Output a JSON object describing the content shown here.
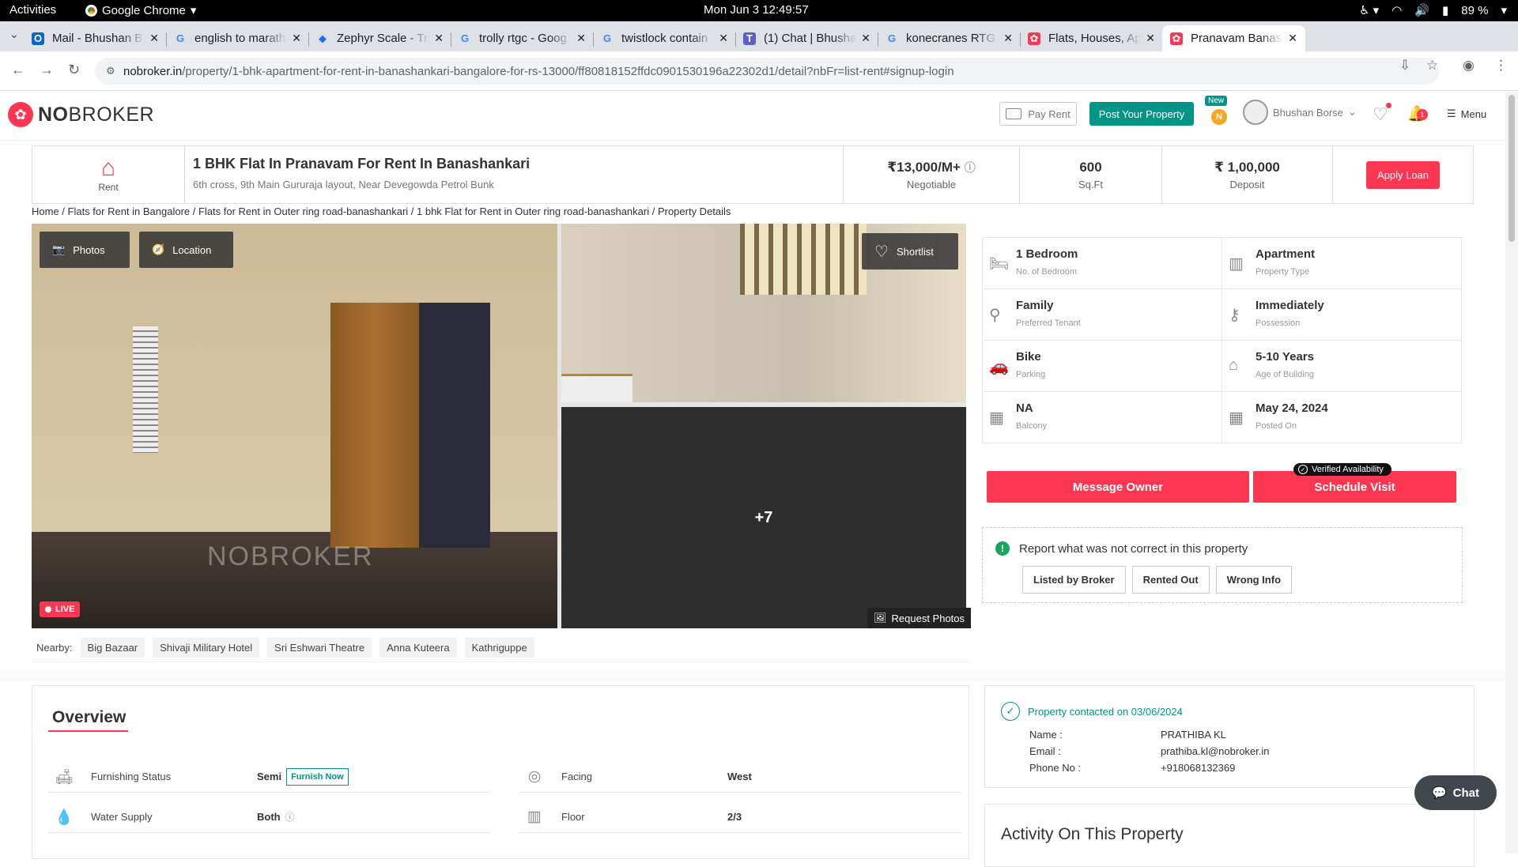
{
  "system": {
    "activities": "Activities",
    "app_name": "Google Chrome",
    "clock": "Mon Jun 3  12:49:57",
    "battery": "89 %"
  },
  "tabs": [
    {
      "title": "Mail - Bhushan B",
      "icon": "outlook-icon"
    },
    {
      "title": "english to marathi",
      "icon": "google-icon"
    },
    {
      "title": "Zephyr Scale - Tr",
      "icon": "zephyr-icon"
    },
    {
      "title": "trolly rtgc - Goog",
      "icon": "google-icon"
    },
    {
      "title": "twistlock contain",
      "icon": "google-icon"
    },
    {
      "title": "(1) Chat | Bhusha",
      "icon": "teams-icon"
    },
    {
      "title": "konecranes RTG",
      "icon": "google-icon"
    },
    {
      "title": "Flats, Houses, Ap",
      "icon": "nobroker-icon"
    },
    {
      "title": "Pranavam Banasl",
      "icon": "nobroker-icon",
      "active": true
    }
  ],
  "address_bar": {
    "host": "nobroker.in",
    "path": "/property/1-bhk-apartment-for-rent-in-banashankari-bangalore-for-rs-13000/ff80818152ffdc0901530196a22302d1/detail?nbFr=list-rent#signup-login"
  },
  "header": {
    "logo_bold": "NO",
    "logo_rest": "BROKER",
    "pay_rent": "Pay Rent",
    "post_property": "Post Your Property",
    "new_badge": "New",
    "coin": "N",
    "user_name": "Bhushan Borse",
    "notifications": "1",
    "menu": "Menu"
  },
  "summary": {
    "category": "Rent",
    "title": "1 BHK Flat In Pranavam For Rent In Banashankari",
    "address": "6th cross, 9th Main Gururaja layout, Near Devegowda Petrol Bunk",
    "rent": "₹13,000/M+",
    "rent_note": "Negotiable",
    "area": "600",
    "area_unit": "Sq.Ft",
    "deposit": "₹ 1,00,000",
    "deposit_label": "Deposit",
    "apply_loan": "Apply Loan"
  },
  "breadcrumb": "Home / Flats for Rent in Bangalore / Flats for Rent in Outer ring road-banashankari / 1 bhk Flat for Rent in Outer ring road-banashankari / Property Details",
  "gallery": {
    "photos": "Photos",
    "location": "Location",
    "shortlist": "Shortlist",
    "more": "+7",
    "live": "LIVE",
    "request_photos": "Request Photos",
    "watermark": "NOBROKER"
  },
  "nearby": {
    "label": "Nearby:",
    "places": [
      "Big Bazaar",
      "Shivaji Military Hotel",
      "Sri Eshwari Theatre",
      "Anna Kuteera",
      "Kathriguppe"
    ]
  },
  "details": [
    {
      "value": "1 Bedroom",
      "label": "No. of Bedroom",
      "icon": "bed-icon"
    },
    {
      "value": "Apartment",
      "label": "Property Type",
      "icon": "building-icon"
    },
    {
      "value": "Family",
      "label": "Preferred Tenant",
      "icon": "tenant-icon"
    },
    {
      "value": "Immediately",
      "label": "Possession",
      "icon": "key-icon"
    },
    {
      "value": "Bike",
      "label": "Parking",
      "icon": "car-icon"
    },
    {
      "value": "5-10 Years",
      "label": "Age of Building",
      "icon": "age-icon"
    },
    {
      "value": "NA",
      "label": "Balcony",
      "icon": "balcony-icon"
    },
    {
      "value": "May 24, 2024",
      "label": "Posted On",
      "icon": "calendar-icon"
    }
  ],
  "actions": {
    "message_owner": "Message Owner",
    "schedule_visit": "Schedule Visit",
    "verified": "Verified Availability"
  },
  "report": {
    "heading": "Report what was not correct in this property",
    "options": [
      "Listed by Broker",
      "Rented Out",
      "Wrong Info"
    ]
  },
  "overview": {
    "title": "Overview",
    "rows": [
      {
        "key": "Furnishing Status",
        "value": "Semi",
        "extra": "Furnish Now",
        "icon": "sofa-icon"
      },
      {
        "key": "Facing",
        "value": "West",
        "icon": "compass-icon"
      },
      {
        "key": "Water Supply",
        "value": "Both",
        "icon": "water-drop-icon"
      },
      {
        "key": "Floor",
        "value": "2/3",
        "icon": "floor-icon"
      }
    ]
  },
  "contact": {
    "status": "Property contacted on 03/06/2024",
    "name_label": "Name :",
    "name": "PRATHIBA KL",
    "email_label": "Email :",
    "email": "prathiba.kl@nobroker.in",
    "phone_label": "Phone No :",
    "phone": "+918068132369"
  },
  "activity": {
    "title": "Activity On This Property"
  },
  "chat": "Chat",
  "colors": {
    "brand": "#fd3752",
    "teal": "#009587"
  }
}
